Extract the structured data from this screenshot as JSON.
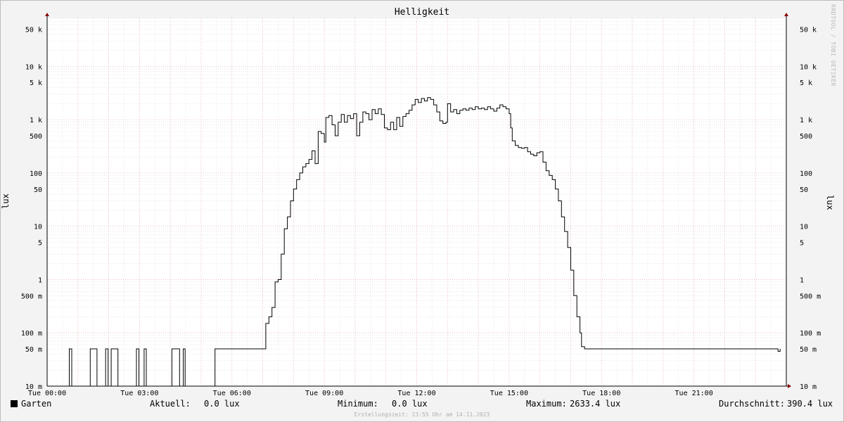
{
  "chart_data": {
    "type": "line",
    "title": "Helligkeit",
    "ylabel": "lux",
    "y_scale": "log",
    "ylim": [
      0.01,
      80000
    ],
    "xlim": [
      0,
      24
    ],
    "x_ticks": [
      {
        "x": 0,
        "label": "Tue 00:00"
      },
      {
        "x": 3,
        "label": "Tue 03:00"
      },
      {
        "x": 6,
        "label": "Tue 06:00"
      },
      {
        "x": 9,
        "label": "Tue 09:00"
      },
      {
        "x": 12,
        "label": "Tue 12:00"
      },
      {
        "x": 15,
        "label": "Tue 15:00"
      },
      {
        "x": 18,
        "label": "Tue 18:00"
      },
      {
        "x": 21,
        "label": "Tue 21:00"
      }
    ],
    "y_ticks": [
      {
        "y": 50000,
        "label": "50 k"
      },
      {
        "y": 10000,
        "label": "10 k"
      },
      {
        "y": 5000,
        "label": "5 k"
      },
      {
        "y": 1000,
        "label": "1 k"
      },
      {
        "y": 500,
        "label": "500"
      },
      {
        "y": 100,
        "label": "100"
      },
      {
        "y": 50,
        "label": "50"
      },
      {
        "y": 10,
        "label": "10"
      },
      {
        "y": 5,
        "label": "5"
      },
      {
        "y": 1,
        "label": "1"
      },
      {
        "y": 0.5,
        "label": "500 m"
      },
      {
        "y": 0.1,
        "label": "100 m"
      },
      {
        "y": 0.05,
        "label": "50 m"
      },
      {
        "y": 0.01,
        "label": "10 m"
      }
    ],
    "series": [
      {
        "name": "Garten",
        "color": "#000000",
        "points": [
          [
            0.0,
            0.01
          ],
          [
            0.72,
            0.01
          ],
          [
            0.72,
            0.05
          ],
          [
            0.8,
            0.05
          ],
          [
            0.8,
            0.01
          ],
          [
            1.4,
            0.01
          ],
          [
            1.4,
            0.05
          ],
          [
            1.62,
            0.05
          ],
          [
            1.62,
            0.01
          ],
          [
            1.9,
            0.01
          ],
          [
            1.9,
            0.05
          ],
          [
            1.98,
            0.05
          ],
          [
            1.98,
            0.01
          ],
          [
            2.08,
            0.01
          ],
          [
            2.08,
            0.05
          ],
          [
            2.3,
            0.05
          ],
          [
            2.3,
            0.01
          ],
          [
            2.9,
            0.01
          ],
          [
            2.9,
            0.05
          ],
          [
            2.98,
            0.05
          ],
          [
            2.98,
            0.01
          ],
          [
            3.15,
            0.01
          ],
          [
            3.15,
            0.05
          ],
          [
            3.22,
            0.05
          ],
          [
            3.22,
            0.01
          ],
          [
            4.05,
            0.01
          ],
          [
            4.05,
            0.05
          ],
          [
            4.3,
            0.05
          ],
          [
            4.3,
            0.01
          ],
          [
            4.42,
            0.01
          ],
          [
            4.42,
            0.05
          ],
          [
            4.48,
            0.05
          ],
          [
            4.48,
            0.01
          ],
          [
            5.45,
            0.01
          ],
          [
            5.45,
            0.05
          ],
          [
            7.1,
            0.05
          ],
          [
            7.1,
            0.15
          ],
          [
            7.2,
            0.2
          ],
          [
            7.3,
            0.3
          ],
          [
            7.4,
            0.9
          ],
          [
            7.5,
            1.0
          ],
          [
            7.6,
            3
          ],
          [
            7.7,
            9
          ],
          [
            7.8,
            15
          ],
          [
            7.9,
            30
          ],
          [
            8.0,
            50
          ],
          [
            8.1,
            75
          ],
          [
            8.2,
            100
          ],
          [
            8.3,
            130
          ],
          [
            8.4,
            150
          ],
          [
            8.5,
            180
          ],
          [
            8.6,
            260
          ],
          [
            8.7,
            150
          ],
          [
            8.8,
            600
          ],
          [
            8.9,
            550
          ],
          [
            9.0,
            380
          ],
          [
            9.05,
            1100
          ],
          [
            9.15,
            1200
          ],
          [
            9.25,
            800
          ],
          [
            9.35,
            500
          ],
          [
            9.45,
            900
          ],
          [
            9.55,
            1250
          ],
          [
            9.65,
            900
          ],
          [
            9.75,
            1200
          ],
          [
            9.85,
            1050
          ],
          [
            9.95,
            1300
          ],
          [
            10.05,
            500
          ],
          [
            10.15,
            900
          ],
          [
            10.25,
            1400
          ],
          [
            10.35,
            1300
          ],
          [
            10.45,
            1000
          ],
          [
            10.55,
            1550
          ],
          [
            10.65,
            1300
          ],
          [
            10.75,
            1600
          ],
          [
            10.85,
            1250
          ],
          [
            10.95,
            700
          ],
          [
            11.05,
            650
          ],
          [
            11.15,
            900
          ],
          [
            11.25,
            650
          ],
          [
            11.35,
            1100
          ],
          [
            11.45,
            750
          ],
          [
            11.55,
            1150
          ],
          [
            11.65,
            1300
          ],
          [
            11.75,
            1500
          ],
          [
            11.85,
            1900
          ],
          [
            11.95,
            2400
          ],
          [
            12.05,
            2100
          ],
          [
            12.15,
            2500
          ],
          [
            12.25,
            2250
          ],
          [
            12.35,
            2600
          ],
          [
            12.45,
            2400
          ],
          [
            12.55,
            1900
          ],
          [
            12.65,
            1400
          ],
          [
            12.75,
            950
          ],
          [
            12.85,
            850
          ],
          [
            12.95,
            900
          ],
          [
            13.0,
            2000
          ],
          [
            13.1,
            1400
          ],
          [
            13.2,
            1550
          ],
          [
            13.3,
            1300
          ],
          [
            13.4,
            1500
          ],
          [
            13.5,
            1600
          ],
          [
            13.6,
            1500
          ],
          [
            13.7,
            1650
          ],
          [
            13.8,
            1550
          ],
          [
            13.9,
            1750
          ],
          [
            14.0,
            1600
          ],
          [
            14.1,
            1650
          ],
          [
            14.2,
            1550
          ],
          [
            14.3,
            1750
          ],
          [
            14.4,
            1600
          ],
          [
            14.5,
            1450
          ],
          [
            14.6,
            1650
          ],
          [
            14.7,
            1900
          ],
          [
            14.8,
            1750
          ],
          [
            14.9,
            1600
          ],
          [
            15.0,
            1300
          ],
          [
            15.05,
            700
          ],
          [
            15.1,
            400
          ],
          [
            15.2,
            330
          ],
          [
            15.3,
            300
          ],
          [
            15.4,
            290
          ],
          [
            15.5,
            300
          ],
          [
            15.6,
            250
          ],
          [
            15.7,
            225
          ],
          [
            15.8,
            210
          ],
          [
            15.9,
            240
          ],
          [
            16.0,
            250
          ],
          [
            16.1,
            160
          ],
          [
            16.2,
            110
          ],
          [
            16.3,
            90
          ],
          [
            16.4,
            75
          ],
          [
            16.5,
            50
          ],
          [
            16.6,
            30
          ],
          [
            16.7,
            15
          ],
          [
            16.8,
            8
          ],
          [
            16.9,
            4
          ],
          [
            17.0,
            1.5
          ],
          [
            17.1,
            0.5
          ],
          [
            17.2,
            0.2
          ],
          [
            17.3,
            0.1
          ],
          [
            17.35,
            0.055
          ],
          [
            17.45,
            0.05
          ],
          [
            23.65,
            0.05
          ],
          [
            23.73,
            0.045
          ],
          [
            23.8,
            0.05
          ]
        ]
      }
    ],
    "grid": true
  },
  "legend": {
    "series_name": "Garten",
    "current_label": "Aktuell:",
    "current_value": "0.0 lux",
    "min_label": "Minimum:",
    "min_value": "0.0 lux",
    "max_label": "Maximum:",
    "max_value": "2633.4 lux",
    "avg_label": "Durchschnitt:",
    "avg_value": "390.4 lux"
  },
  "footer": "Erstellungszeit: 23:55 Uhr am 14.11.2023",
  "watermark": "RRDTOOL / TOBI OETIKER",
  "colors": {
    "background": "#f3f3f3",
    "plot_background": "#ffffff",
    "minor_grid": "#d8d8d8",
    "major_grid": "#e7a9a9",
    "axis": "#8b0000",
    "line": "#000000"
  }
}
